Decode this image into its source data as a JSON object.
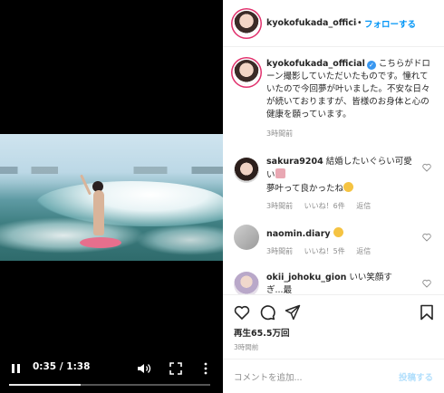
{
  "player": {
    "current_time": "0:35",
    "duration": "1:38",
    "time_separator": " / ",
    "progress": 0.357,
    "icons": [
      "pause-icon",
      "volume-icon",
      "fullscreen-icon",
      "more-options-icon"
    ]
  },
  "header": {
    "username": "kyokofukada_official",
    "separator": "•",
    "follow_label": "フォローする"
  },
  "caption": {
    "username": "kyokofukada_official",
    "verified_mark": "✓",
    "text": "こちらがドローン撮影していただいたものです。憧れていたので今回夢が叶いました。不安な日々が続いておりますが、皆様のお身体と心の健康を願っています。",
    "timestamp": "3時間前"
  },
  "comments": [
    {
      "username": "sakura9204",
      "text_line1": "結婚したいぐらい可愛い",
      "text_line2": "夢叶って良かったね",
      "time": "3時間前",
      "likes": "いいね！6件",
      "reply": "返信"
    },
    {
      "username": "naomin.diary",
      "text": "",
      "time": "3時間前",
      "likes": "いいね！5件",
      "reply": "返信"
    },
    {
      "username": "okii_johoku_gion",
      "text": "いい笑顔す",
      "text_line2": "ぎ...",
      "text_line3": "最"
    }
  ],
  "actions": {
    "icons": [
      "heart-icon",
      "comment-icon",
      "share-icon",
      "bookmark-icon"
    ],
    "plays": "再生65.5万回",
    "posted_ago": "3時間前"
  },
  "add_comment": {
    "placeholder": "コメントを追加...",
    "post_label": "投稿する"
  }
}
